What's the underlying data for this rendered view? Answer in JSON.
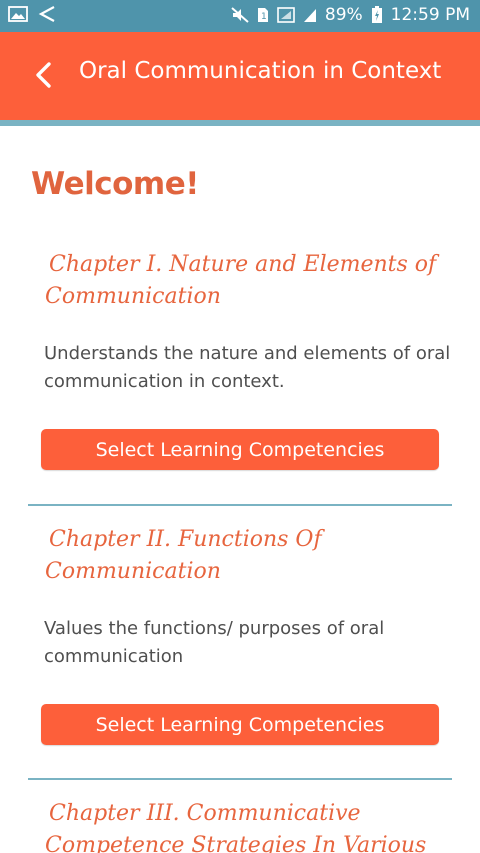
{
  "status_bar": {
    "battery": "89%",
    "time": "12:59 PM",
    "icons": [
      "gallery-icon",
      "back-arrow-icon",
      "mute-icon",
      "sim-icon",
      "signal-box-icon",
      "signal-icon",
      "battery-charging-icon"
    ]
  },
  "header": {
    "title": "Oral Communication in Context",
    "back_icon": "chevron-left-icon"
  },
  "main": {
    "welcome": "Welcome!",
    "chapters": [
      {
        "title": "Chapter I. Nature and Elements of Communication",
        "description": " Understands the nature and elements of oral communication in context.",
        "button_label": "Select Learning Competencies"
      },
      {
        "title": "Chapter II. Functions Of Communication",
        "description": " Values the functions/ purposes of oral communication",
        "button_label": "Select Learning Competencies"
      },
      {
        "title": "Chapter III. Communicative Competence Strategies In Various Speech Situations",
        "description": "",
        "button_label": ""
      }
    ]
  },
  "colors": {
    "app_bar": "#fd5f3a",
    "status_bar": "#4f94ab",
    "accent_text": "#e7653e",
    "divider": "#7ab3c3"
  }
}
